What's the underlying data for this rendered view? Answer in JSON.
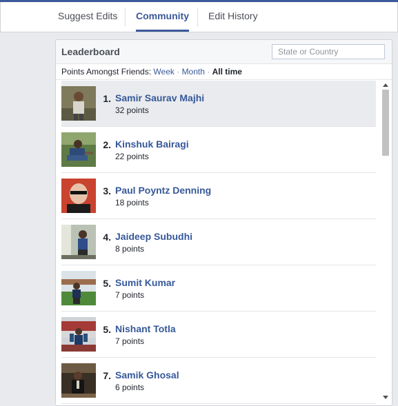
{
  "tabs": [
    {
      "label": "Suggest Edits",
      "active": false
    },
    {
      "label": "Community",
      "active": true
    },
    {
      "label": "Edit History",
      "active": false
    }
  ],
  "leaderboard": {
    "title": "Leaderboard",
    "search_placeholder": "State or Country",
    "filter_prefix": "Points Amongst Friends:",
    "filters": {
      "week": "Week",
      "month": "Month",
      "all_time": "All time"
    },
    "filter_separator": "·",
    "entries": [
      {
        "rank": "1.",
        "name": "Samir Saurav Majhi",
        "points": "32 points"
      },
      {
        "rank": "2.",
        "name": "Kinshuk Bairagi",
        "points": "22 points"
      },
      {
        "rank": "3.",
        "name": "Paul Poyntz Denning",
        "points": "18 points"
      },
      {
        "rank": "4.",
        "name": "Jaideep Subudhi",
        "points": "8 points"
      },
      {
        "rank": "5.",
        "name": "Sumit Kumar",
        "points": "7 points"
      },
      {
        "rank": "5.",
        "name": "Nishant Totla",
        "points": "7 points"
      },
      {
        "rank": "7.",
        "name": "Samik Ghosal",
        "points": "6 points"
      }
    ]
  },
  "colors": {
    "accent": "#3b5998",
    "link": "#365899",
    "highlight_row": "#e9ebee"
  }
}
